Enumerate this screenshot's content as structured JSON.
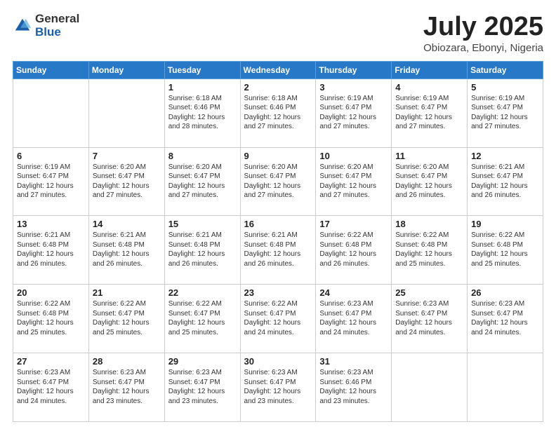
{
  "header": {
    "logo_general": "General",
    "logo_blue": "Blue",
    "title": "July 2025",
    "location": "Obiozara, Ebonyi, Nigeria"
  },
  "weekdays": [
    "Sunday",
    "Monday",
    "Tuesday",
    "Wednesday",
    "Thursday",
    "Friday",
    "Saturday"
  ],
  "weeks": [
    [
      {
        "day": null,
        "sunrise": null,
        "sunset": null,
        "daylight": null
      },
      {
        "day": null,
        "sunrise": null,
        "sunset": null,
        "daylight": null
      },
      {
        "day": 1,
        "sunrise": "Sunrise: 6:18 AM",
        "sunset": "Sunset: 6:46 PM",
        "daylight": "Daylight: 12 hours and 28 minutes."
      },
      {
        "day": 2,
        "sunrise": "Sunrise: 6:18 AM",
        "sunset": "Sunset: 6:46 PM",
        "daylight": "Daylight: 12 hours and 27 minutes."
      },
      {
        "day": 3,
        "sunrise": "Sunrise: 6:19 AM",
        "sunset": "Sunset: 6:47 PM",
        "daylight": "Daylight: 12 hours and 27 minutes."
      },
      {
        "day": 4,
        "sunrise": "Sunrise: 6:19 AM",
        "sunset": "Sunset: 6:47 PM",
        "daylight": "Daylight: 12 hours and 27 minutes."
      },
      {
        "day": 5,
        "sunrise": "Sunrise: 6:19 AM",
        "sunset": "Sunset: 6:47 PM",
        "daylight": "Daylight: 12 hours and 27 minutes."
      }
    ],
    [
      {
        "day": 6,
        "sunrise": "Sunrise: 6:19 AM",
        "sunset": "Sunset: 6:47 PM",
        "daylight": "Daylight: 12 hours and 27 minutes."
      },
      {
        "day": 7,
        "sunrise": "Sunrise: 6:20 AM",
        "sunset": "Sunset: 6:47 PM",
        "daylight": "Daylight: 12 hours and 27 minutes."
      },
      {
        "day": 8,
        "sunrise": "Sunrise: 6:20 AM",
        "sunset": "Sunset: 6:47 PM",
        "daylight": "Daylight: 12 hours and 27 minutes."
      },
      {
        "day": 9,
        "sunrise": "Sunrise: 6:20 AM",
        "sunset": "Sunset: 6:47 PM",
        "daylight": "Daylight: 12 hours and 27 minutes."
      },
      {
        "day": 10,
        "sunrise": "Sunrise: 6:20 AM",
        "sunset": "Sunset: 6:47 PM",
        "daylight": "Daylight: 12 hours and 27 minutes."
      },
      {
        "day": 11,
        "sunrise": "Sunrise: 6:20 AM",
        "sunset": "Sunset: 6:47 PM",
        "daylight": "Daylight: 12 hours and 26 minutes."
      },
      {
        "day": 12,
        "sunrise": "Sunrise: 6:21 AM",
        "sunset": "Sunset: 6:47 PM",
        "daylight": "Daylight: 12 hours and 26 minutes."
      }
    ],
    [
      {
        "day": 13,
        "sunrise": "Sunrise: 6:21 AM",
        "sunset": "Sunset: 6:48 PM",
        "daylight": "Daylight: 12 hours and 26 minutes."
      },
      {
        "day": 14,
        "sunrise": "Sunrise: 6:21 AM",
        "sunset": "Sunset: 6:48 PM",
        "daylight": "Daylight: 12 hours and 26 minutes."
      },
      {
        "day": 15,
        "sunrise": "Sunrise: 6:21 AM",
        "sunset": "Sunset: 6:48 PM",
        "daylight": "Daylight: 12 hours and 26 minutes."
      },
      {
        "day": 16,
        "sunrise": "Sunrise: 6:21 AM",
        "sunset": "Sunset: 6:48 PM",
        "daylight": "Daylight: 12 hours and 26 minutes."
      },
      {
        "day": 17,
        "sunrise": "Sunrise: 6:22 AM",
        "sunset": "Sunset: 6:48 PM",
        "daylight": "Daylight: 12 hours and 26 minutes."
      },
      {
        "day": 18,
        "sunrise": "Sunrise: 6:22 AM",
        "sunset": "Sunset: 6:48 PM",
        "daylight": "Daylight: 12 hours and 25 minutes."
      },
      {
        "day": 19,
        "sunrise": "Sunrise: 6:22 AM",
        "sunset": "Sunset: 6:48 PM",
        "daylight": "Daylight: 12 hours and 25 minutes."
      }
    ],
    [
      {
        "day": 20,
        "sunrise": "Sunrise: 6:22 AM",
        "sunset": "Sunset: 6:48 PM",
        "daylight": "Daylight: 12 hours and 25 minutes."
      },
      {
        "day": 21,
        "sunrise": "Sunrise: 6:22 AM",
        "sunset": "Sunset: 6:47 PM",
        "daylight": "Daylight: 12 hours and 25 minutes."
      },
      {
        "day": 22,
        "sunrise": "Sunrise: 6:22 AM",
        "sunset": "Sunset: 6:47 PM",
        "daylight": "Daylight: 12 hours and 25 minutes."
      },
      {
        "day": 23,
        "sunrise": "Sunrise: 6:22 AM",
        "sunset": "Sunset: 6:47 PM",
        "daylight": "Daylight: 12 hours and 24 minutes."
      },
      {
        "day": 24,
        "sunrise": "Sunrise: 6:23 AM",
        "sunset": "Sunset: 6:47 PM",
        "daylight": "Daylight: 12 hours and 24 minutes."
      },
      {
        "day": 25,
        "sunrise": "Sunrise: 6:23 AM",
        "sunset": "Sunset: 6:47 PM",
        "daylight": "Daylight: 12 hours and 24 minutes."
      },
      {
        "day": 26,
        "sunrise": "Sunrise: 6:23 AM",
        "sunset": "Sunset: 6:47 PM",
        "daylight": "Daylight: 12 hours and 24 minutes."
      }
    ],
    [
      {
        "day": 27,
        "sunrise": "Sunrise: 6:23 AM",
        "sunset": "Sunset: 6:47 PM",
        "daylight": "Daylight: 12 hours and 24 minutes."
      },
      {
        "day": 28,
        "sunrise": "Sunrise: 6:23 AM",
        "sunset": "Sunset: 6:47 PM",
        "daylight": "Daylight: 12 hours and 23 minutes."
      },
      {
        "day": 29,
        "sunrise": "Sunrise: 6:23 AM",
        "sunset": "Sunset: 6:47 PM",
        "daylight": "Daylight: 12 hours and 23 minutes."
      },
      {
        "day": 30,
        "sunrise": "Sunrise: 6:23 AM",
        "sunset": "Sunset: 6:47 PM",
        "daylight": "Daylight: 12 hours and 23 minutes."
      },
      {
        "day": 31,
        "sunrise": "Sunrise: 6:23 AM",
        "sunset": "Sunset: 6:46 PM",
        "daylight": "Daylight: 12 hours and 23 minutes."
      },
      {
        "day": null,
        "sunrise": null,
        "sunset": null,
        "daylight": null
      },
      {
        "day": null,
        "sunrise": null,
        "sunset": null,
        "daylight": null
      }
    ]
  ]
}
